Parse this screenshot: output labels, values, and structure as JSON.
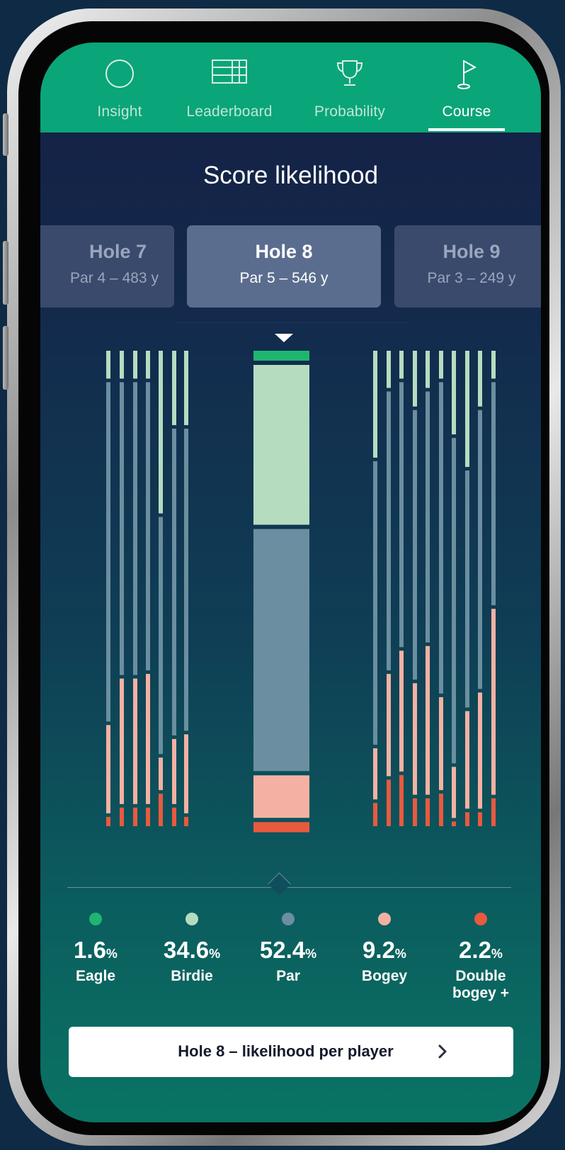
{
  "tabs": [
    {
      "label": "Insight",
      "icon": "circle-icon"
    },
    {
      "label": "Leaderboard",
      "icon": "table-icon"
    },
    {
      "label": "Probability",
      "icon": "trophy-icon"
    },
    {
      "label": "Course",
      "icon": "flag-icon",
      "active": true
    }
  ],
  "header": {
    "title": "Score likelihood"
  },
  "holes": [
    {
      "name": "Hole 7",
      "sub": "Par 4 – 483 y"
    },
    {
      "name": "Hole 8",
      "sub": "Par 5 – 546 y",
      "selected": true
    },
    {
      "name": "Hole 9",
      "sub": "Par 3 – 249 y"
    }
  ],
  "legend": [
    {
      "value": "1.6",
      "unit": "%",
      "label": "Eagle",
      "color": "#1fb571"
    },
    {
      "value": "34.6",
      "unit": "%",
      "label": "Birdie",
      "color": "#b6dcc0"
    },
    {
      "value": "52.4",
      "unit": "%",
      "label": "Par",
      "color": "#6b8fa0"
    },
    {
      "value": "9.2",
      "unit": "%",
      "label": "Bogey",
      "color": "#f4b1a3"
    },
    {
      "value": "2.2",
      "unit": "%",
      "label": "Double bogey +",
      "label_line1": "Double",
      "label_line2": "bogey +",
      "color": "#e85a3f"
    }
  ],
  "cta": {
    "label": "Hole 8 – likelihood per player",
    "icon": "chevron-right-icon"
  },
  "chart_data": {
    "type": "bar",
    "categories": [
      "Eagle",
      "Birdie",
      "Par",
      "Bogey",
      "Double bogey +"
    ],
    "values": [
      1.6,
      34.6,
      52.4,
      9.2,
      2.2
    ],
    "colors": [
      "#1fb571",
      "#b6dcc0",
      "#6b8fa0",
      "#f4b1a3",
      "#e85a3f"
    ],
    "players": [
      [
        0,
        6,
        73,
        19,
        2
      ],
      [
        0,
        6,
        63,
        27,
        4
      ],
      [
        0,
        6,
        63,
        27,
        4
      ],
      [
        0,
        6,
        62,
        28,
        4
      ],
      [
        0,
        35,
        51,
        7,
        7
      ],
      [
        0,
        16,
        66,
        14,
        4
      ],
      [
        0,
        16,
        65,
        17,
        2
      ],
      [
        0,
        23,
        61,
        11,
        5
      ],
      [
        0,
        8,
        60,
        22,
        10
      ],
      [
        0,
        6,
        57,
        26,
        11
      ],
      [
        0,
        12,
        58,
        24,
        6
      ],
      [
        0,
        8,
        54,
        32,
        6
      ],
      [
        0,
        6,
        67,
        20,
        7
      ],
      [
        0,
        18,
        70,
        11,
        1
      ],
      [
        0,
        25,
        51,
        21,
        3
      ],
      [
        0,
        12,
        60,
        25,
        3
      ],
      [
        0,
        6,
        48,
        40,
        6
      ],
      [
        0,
        6,
        54,
        37,
        3
      ]
    ]
  }
}
